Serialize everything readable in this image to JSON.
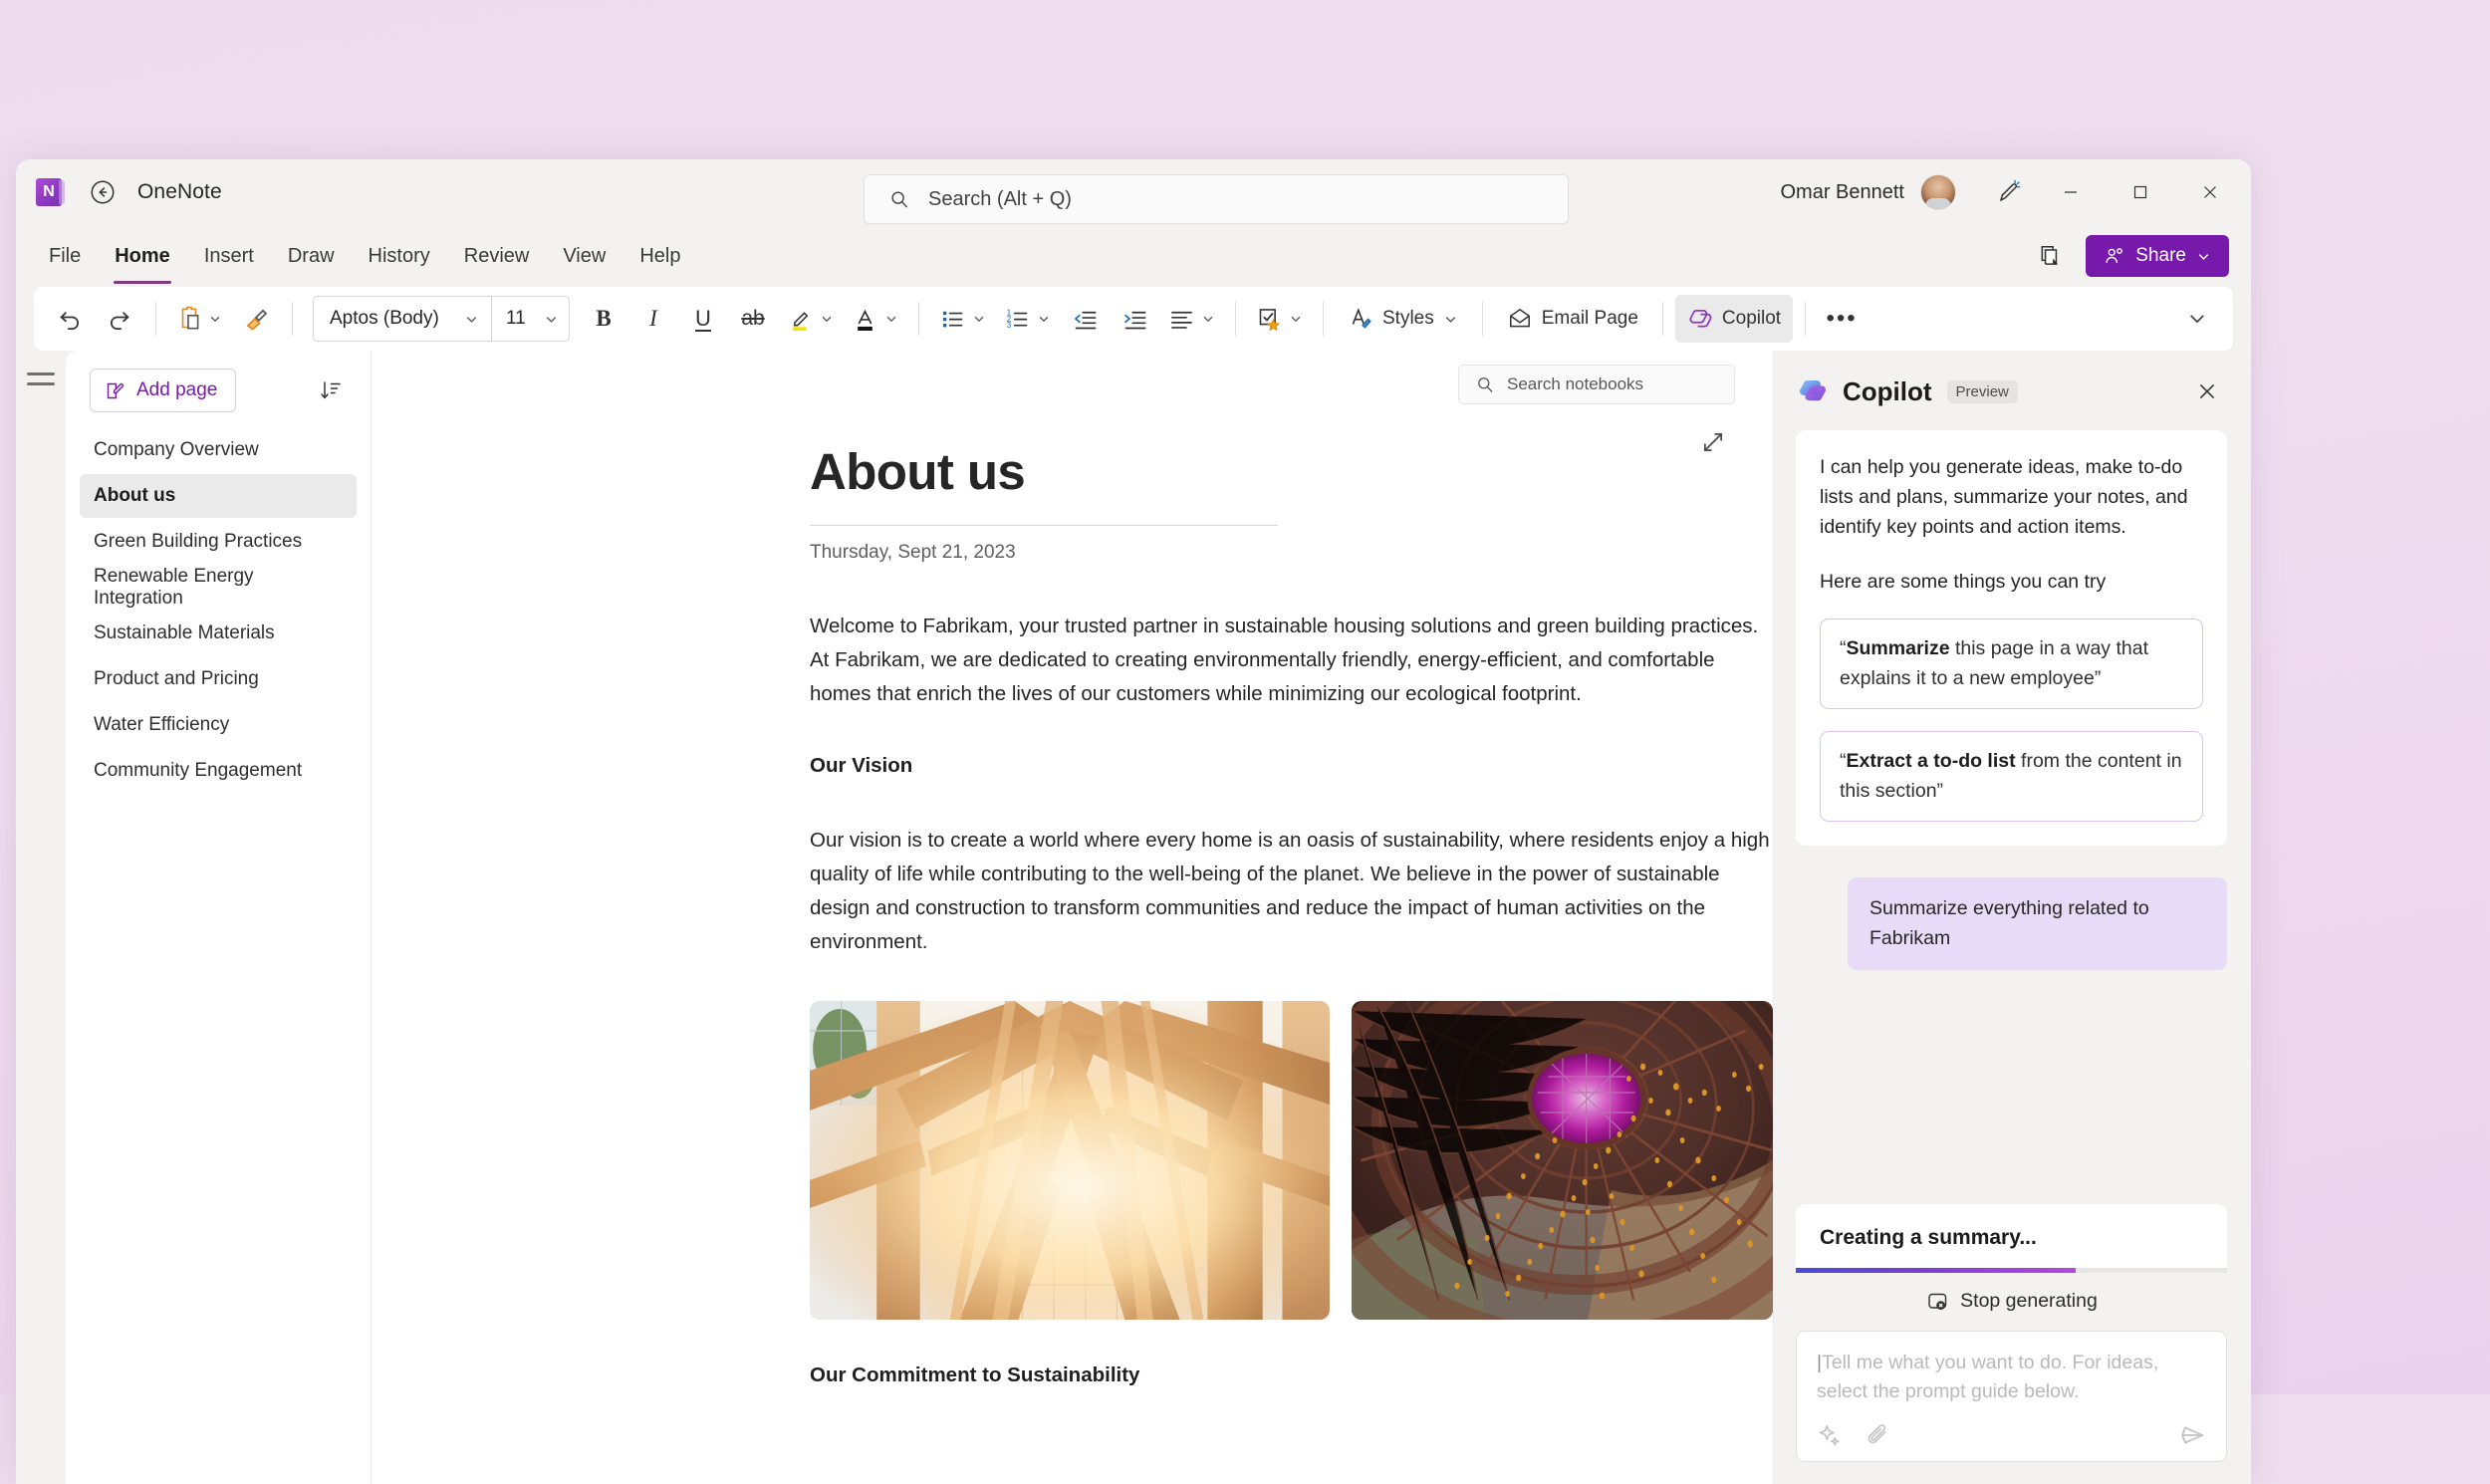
{
  "titlebar": {
    "app_name": "OneNote",
    "back_icon": "back-arrow-icon",
    "logo_letter": "N",
    "search_placeholder": "Search (Alt + Q)",
    "search_icon": "search-icon",
    "user_name": "Omar Bennett",
    "avatar_icon": "user-avatar",
    "feedback_icon": "pen-sparkle-icon",
    "minimize_icon": "minimize-icon",
    "maximize_icon": "maximize-icon",
    "close_icon": "close-icon"
  },
  "ribbon": {
    "tabs": [
      {
        "label": "File",
        "active": false
      },
      {
        "label": "Home",
        "active": true
      },
      {
        "label": "Insert",
        "active": false
      },
      {
        "label": "Draw",
        "active": false
      },
      {
        "label": "History",
        "active": false
      },
      {
        "label": "Review",
        "active": false
      },
      {
        "label": "View",
        "active": false
      },
      {
        "label": "Help",
        "active": false
      }
    ],
    "pages_icon": "pages-pane-icon",
    "share_label": "Share",
    "share_icon": "share-person-icon",
    "share_chevron": "chevron-down-icon"
  },
  "toolbar": {
    "undo_icon": "undo-icon",
    "redo_icon": "redo-icon",
    "paste_icon": "paste-icon",
    "format_painter_icon": "format-painter-icon",
    "font_name": "Aptos (Body)",
    "font_size": "11",
    "bold_label": "B",
    "italic_label": "I",
    "underline_label": "U",
    "strikethrough_label": "ab",
    "highlight_icon": "text-highlight-icon",
    "font_color_icon": "font-color-icon",
    "bullets_icon": "bulleted-list-icon",
    "numbering_icon": "numbered-list-icon",
    "decrease_indent_icon": "decrease-indent-icon",
    "increase_indent_icon": "increase-indent-icon",
    "align_icon": "align-left-icon",
    "tags_icon": "todo-tag-icon",
    "styles_label": "Styles",
    "styles_icon": "styles-icon",
    "email_page_label": "Email Page",
    "email_page_icon": "envelope-icon",
    "copilot_label": "Copilot",
    "copilot_icon": "copilot-icon",
    "more_label": "•••",
    "expand_icon": "chevron-down-icon"
  },
  "sidebar": {
    "menu_icon": "hamburger-menu-icon",
    "add_page_label": "Add page",
    "add_page_icon": "new-page-icon",
    "sort_icon": "sort-descending-icon",
    "items": [
      {
        "label": "Company Overview",
        "selected": false
      },
      {
        "label": "About us",
        "selected": true
      },
      {
        "label": "Green Building Practices",
        "selected": false
      },
      {
        "label": "Renewable Energy Integration",
        "selected": false
      },
      {
        "label": "Sustainable Materials",
        "selected": false
      },
      {
        "label": "Product and Pricing",
        "selected": false
      },
      {
        "label": "Water Efficiency",
        "selected": false
      },
      {
        "label": "Community Engagement",
        "selected": false
      }
    ]
  },
  "canvas": {
    "notebook_search_placeholder": "Search notebooks",
    "notebook_search_icon": "search-icon",
    "expand_icon": "expand-diagonal-icon"
  },
  "document": {
    "title": "About us",
    "date": "Thursday, Sept 21, 2023",
    "intro": "Welcome to Fabrikam, your trusted partner in sustainable housing solutions and green building practices. At Fabrikam, we are dedicated to creating environmentally friendly, energy-efficient, and comfortable homes that enrich the lives of our customers while minimizing our ecological footprint.",
    "vision_heading": "Our Vision",
    "vision_body": "Our vision is to create a world where every home is an oasis of sustainability, where residents enjoy a high quality of life while contributing to the well-being of the planet. We believe in the power of sustainable design and construction to transform communities and reduce the impact of human activities on the environment.",
    "image_one_alt": "timber-frame-interior-sunlight-photo",
    "image_two_alt": "dome-atrium-steel-structure-photo",
    "commitment_heading": "Our Commitment to Sustainability"
  },
  "copilot": {
    "title": "Copilot",
    "badge": "Preview",
    "close_icon": "close-icon",
    "logo_icon": "copilot-icon",
    "intro_line_1": "I can help you generate ideas, make to-do lists and plans, summarize your notes, and identify key points and action items.",
    "intro_line_2": "Here are some things you can try",
    "suggestions": [
      {
        "quote_open": "“",
        "bold": "Summarize",
        "rest": " this page in a way that explains it to a new employee”"
      },
      {
        "quote_open": "“",
        "bold": "Extract a to-do list",
        "rest": " from the content in this section”"
      }
    ],
    "user_message": "Summarize everything related to Fabrikam",
    "generating_label": "Creating a summary...",
    "progress_percent": 65,
    "stop_label": "Stop generating",
    "stop_icon": "stop-generating-icon",
    "input_caret": "|",
    "input_placeholder": "Tell me what you want to do. For ideas, select the prompt guide below.",
    "prompt_guide_icon": "sparkle-icon",
    "attach_icon": "paperclip-icon",
    "send_icon": "send-icon"
  },
  "colors": {
    "accent_purple": "#7719aa",
    "tab_underline": "#80397b",
    "user_bubble": "#e8dbf7",
    "suggestion_border": "#dcc4ea"
  }
}
